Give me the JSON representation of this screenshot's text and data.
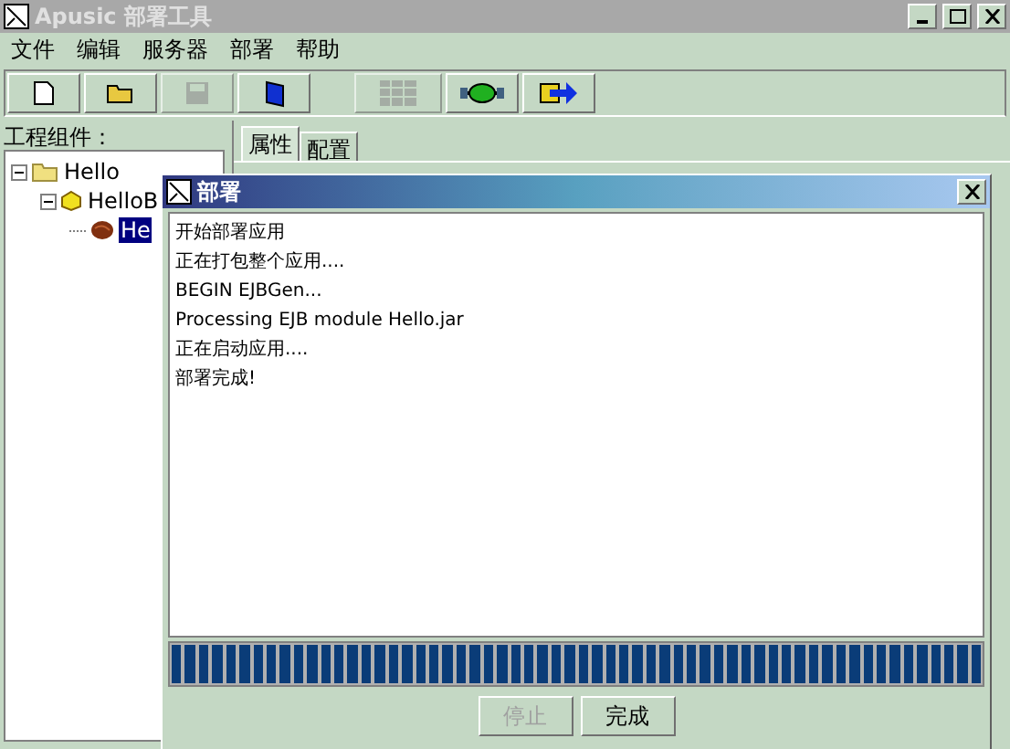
{
  "window": {
    "title": "Apusic 部署工具"
  },
  "menu": [
    "文件",
    "编辑",
    "服务器",
    "部署",
    "帮助"
  ],
  "toolbar": [
    {
      "kind": "new",
      "disabled": false
    },
    {
      "kind": "open",
      "disabled": false
    },
    {
      "kind": "save",
      "disabled": true
    },
    {
      "kind": "book",
      "disabled": false
    },
    {
      "kind": "deploy",
      "disabled": true
    },
    {
      "kind": "connect",
      "disabled": false
    },
    {
      "kind": "export",
      "disabled": false
    }
  ],
  "tree": {
    "label": "工程组件：",
    "items": [
      {
        "label": "Hello",
        "expanded": true,
        "selected": false,
        "children": [
          {
            "label": "HelloB",
            "expanded": true,
            "selected": false,
            "children": [
              {
                "label": "He",
                "selected": true
              }
            ]
          }
        ]
      }
    ]
  },
  "tabs": [
    {
      "label": "属性",
      "selected": true
    },
    {
      "label": "配置",
      "selected": false
    }
  ],
  "dialog": {
    "title": "部署",
    "log": [
      "开始部署应用",
      "正在打包整个应用....",
      "BEGIN EJBGen...",
      "Processing EJB module Hello.jar",
      "正在启动应用....",
      "部署完成!"
    ],
    "progress": {
      "level": 1
    },
    "buttons": [
      {
        "label": "停止",
        "disabled": true
      },
      {
        "label": "完成",
        "disabled": false
      }
    ]
  }
}
